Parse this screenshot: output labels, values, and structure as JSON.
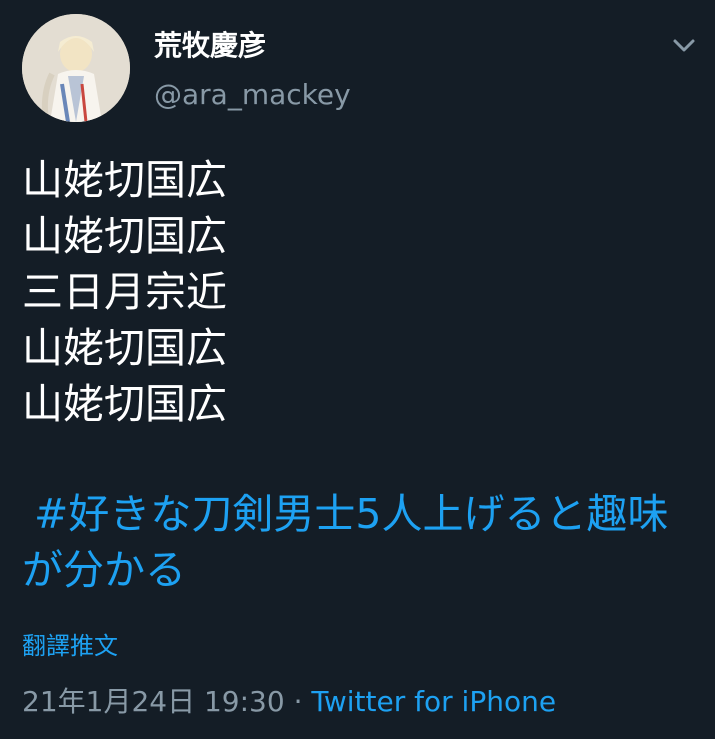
{
  "tweet": {
    "display_name": "荒牧慶彦",
    "handle": "@ara_mackey",
    "lines": [
      "山姥切国広",
      "山姥切国広",
      "三日月宗近",
      "山姥切国広",
      "山姥切国広"
    ],
    "hashtag": "#好きな刀剣男士5人上げると趣味が分かる",
    "translate_label": "翻譯推文",
    "timestamp": "21年1月24日 19:30",
    "separator": "·",
    "source": "Twitter for iPhone"
  },
  "icons": {
    "menu": "chevron-down-icon",
    "avatar": "profile-photo"
  },
  "colors": {
    "background": "#141d26",
    "primary_text": "#ffffff",
    "secondary_text": "#8899a6",
    "link": "#1da1f2"
  }
}
